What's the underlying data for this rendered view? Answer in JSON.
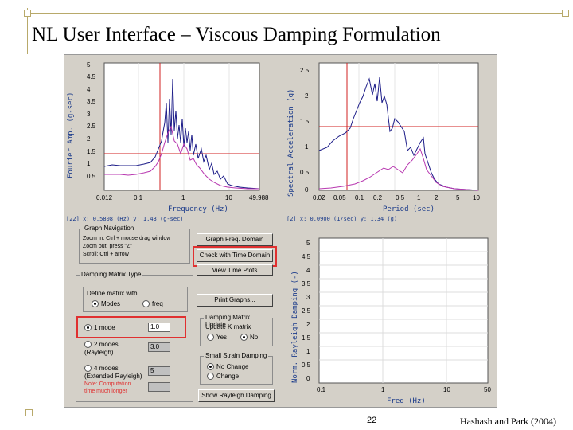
{
  "slide": {
    "title": "NL User Interface – Viscous Damping Formulation",
    "page_number": "22",
    "credit": "Hashash and Park (2004)"
  },
  "plot_fourier": {
    "ylabel": "Fourier Amp. (g-sec)",
    "xlabel": "Frequency (Hz)",
    "yticks": [
      "5",
      "4.5",
      "4",
      "3.5",
      "3",
      "2.5",
      "2",
      "1.5",
      "1",
      "0.5"
    ],
    "xticks": [
      "0.012",
      "0.1",
      "1",
      "10",
      "49.988"
    ],
    "readout": "[22] x: 0.5808 (Hz) y: 1.43 (g-sec)"
  },
  "plot_spectral": {
    "ylabel": "Spectral Acceleration (g)",
    "xlabel": "Period (sec)",
    "yticks": [
      "2.5",
      "2",
      "1.5",
      "1",
      "0.5",
      "0"
    ],
    "xticks": [
      "0.02",
      "0.05",
      "0.1",
      "0.2",
      "0.5",
      "1",
      "2",
      "5",
      "10"
    ],
    "readout": "[2] x: 0.0900 (1/sec) y: 1.34 (g)"
  },
  "plot_damping": {
    "ylabel": "Norm. Rayleigh Damping (-)",
    "xlabel": "Freq (Hz)",
    "yticks": [
      "5",
      "4.5",
      "4",
      "3.5",
      "3",
      "2.5",
      "2",
      "1.5",
      "1",
      "0.5",
      "0"
    ],
    "xticks": [
      "0.1",
      "1",
      "10",
      "50"
    ]
  },
  "graph_nav": {
    "title": "Graph Navigation",
    "lines": [
      "Zoom in: Ctrl + mouse drag window",
      "Zoom out: press \"Z\"",
      "Scroll: Ctrl + arrow"
    ]
  },
  "buttons": {
    "graph_freq": "Graph Freq. Domain",
    "check_time": "Check with Time Domain",
    "view_plots": "View Time Plots",
    "print_graphs": "Print Graphs...",
    "show_rayleigh": "Show Rayleigh Damping"
  },
  "damping_matrix": {
    "title": "Damping Matrix Type",
    "define_label": "Define matrix with",
    "opt_modes": "Modes",
    "opt_freq": "freq",
    "mode1_label": "1 mode",
    "mode1_value": "1.0",
    "mode2_label": "2 modes",
    "mode2_sub": "(Rayleigh)",
    "mode2_value": "3.0",
    "mode4_label": "4 modes",
    "mode4_sub": "(Extended Rayleigh)",
    "mode4_value": "5",
    "note": "Note: Computation time much longer"
  },
  "damping_update": {
    "title": "Damping Matrix Update",
    "label": "Update K matrix",
    "opt_yes": "Yes",
    "opt_no": "No"
  },
  "small_strain": {
    "title": "Small Strain Damping",
    "opt_nochange": "No Change",
    "opt_change": "Change"
  },
  "colors": {
    "accent_red": "#e03030",
    "series_blue": "#1c1c88",
    "series_magenta": "#b838b0",
    "panel": "#d4d0c8"
  }
}
